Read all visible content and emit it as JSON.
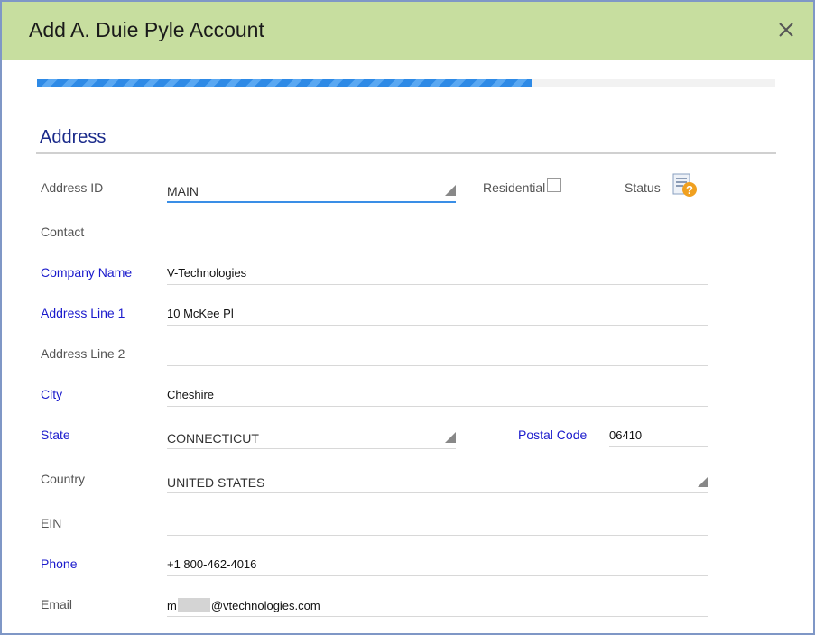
{
  "dialog": {
    "title": "Add A. Duie Pyle Account",
    "close_icon": "close-icon",
    "progress_percent": 67
  },
  "section": {
    "title": "Address"
  },
  "form": {
    "address_id": {
      "label": "Address ID",
      "value": "MAIN"
    },
    "residential": {
      "label": "Residential",
      "checked": false
    },
    "status": {
      "label": "Status",
      "icon": "status-help-icon"
    },
    "contact": {
      "label": "Contact",
      "value": ""
    },
    "company_name": {
      "label": "Company Name",
      "value": "V-Technologies"
    },
    "address_line_1": {
      "label": "Address Line 1",
      "value": "10 McKee Pl"
    },
    "address_line_2": {
      "label": "Address Line 2",
      "value": ""
    },
    "city": {
      "label": "City",
      "value": "Cheshire"
    },
    "state": {
      "label": "State",
      "value": "CONNECTICUT"
    },
    "postal_code": {
      "label": "Postal Code",
      "value": "06410"
    },
    "country": {
      "label": "Country",
      "value": "UNITED STATES"
    },
    "ein": {
      "label": "EIN",
      "value": ""
    },
    "phone": {
      "label": "Phone",
      "value": "+1 800-462-4016"
    },
    "email": {
      "label": "Email",
      "value_prefix": "m",
      "value_suffix": "@vtechnologies.com"
    }
  },
  "colors": {
    "header_bg": "#c7de9f",
    "progress_fill": "#2e8ae6",
    "required_label": "#1a1acc",
    "section_title": "#1a2a8a"
  }
}
